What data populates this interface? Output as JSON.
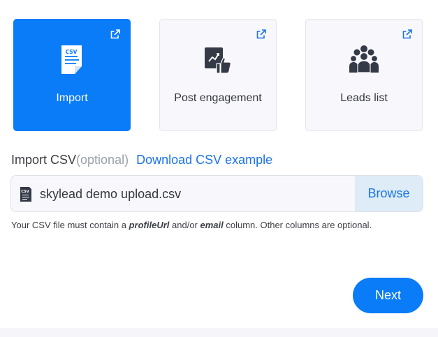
{
  "cards": [
    {
      "label": "Import",
      "icon": "csv-file-icon",
      "active": true
    },
    {
      "label": "Post engagement",
      "icon": "post-engagement-icon",
      "active": false
    },
    {
      "label": "Leads list",
      "icon": "leads-group-icon",
      "active": false
    }
  ],
  "import": {
    "title": "Import CSV",
    "optional": "(optional)",
    "download_link": "Download CSV example"
  },
  "file": {
    "name": "skylead demo upload.csv",
    "browse_label": "Browse"
  },
  "hint": {
    "prefix": "Your CSV file must contain a ",
    "field1": "profileUrl",
    "mid": " and/or ",
    "field2": "email",
    "suffix": " column. Other columns are optional."
  },
  "next_label": "Next",
  "colors": {
    "accent": "#0a7cf8",
    "link": "#1a73e8",
    "browse_bg": "#ddecf6"
  }
}
